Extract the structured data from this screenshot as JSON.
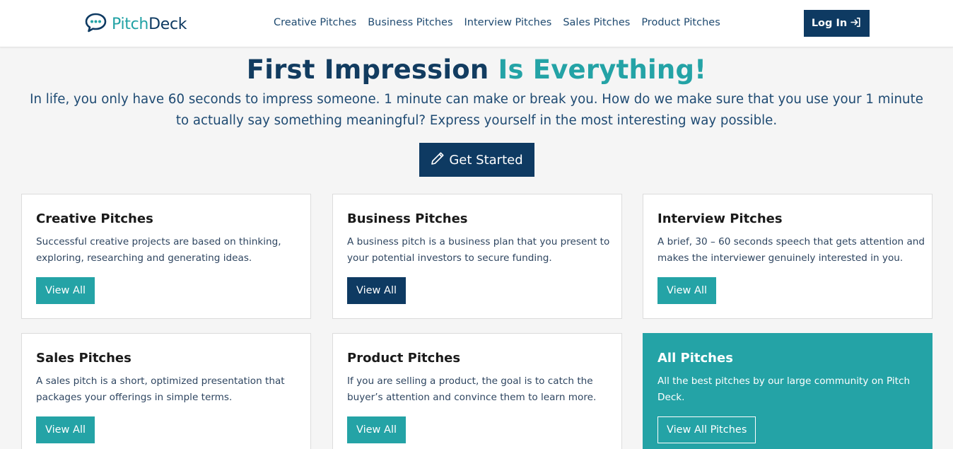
{
  "brand": {
    "pitch": "Pitch",
    "deck": "Deck"
  },
  "nav": {
    "links": [
      "Creative Pitches",
      "Business Pitches",
      "Interview Pitches",
      "Sales Pitches",
      "Product Pitches"
    ],
    "login_label": "Log In"
  },
  "hero": {
    "title_main": "First Impression",
    "title_accent": "Is Everything!",
    "text": "In life, you only have 60 seconds to impress someone. 1 minute can make or break you. How do we make sure that you use your 1 minute to actually say something meaningful? Express yourself in the most interesting way possible.",
    "cta_label": "Get Started"
  },
  "cards": [
    {
      "title": "Creative Pitches",
      "text": "Successful creative projects are based on thinking, exploring, researching and generating ideas.",
      "button": "View All"
    },
    {
      "title": "Business Pitches",
      "text": "A business pitch is a business plan that you present to your potential investors to secure funding.",
      "button": "View All"
    },
    {
      "title": "Interview Pitches",
      "text": "A brief, 30 – 60 seconds speech that gets attention and makes the interviewer genuinely interested in you.",
      "button": "View All"
    },
    {
      "title": "Sales Pitches",
      "text": "A sales pitch is a short, optimized presentation that packages your offerings in simple terms.",
      "button": "View All"
    },
    {
      "title": "Product Pitches",
      "text": "If you are selling a product, the goal is to catch the buyer’s attention and convince them to learn more.",
      "button": "View All"
    },
    {
      "title": "All Pitches",
      "text": "All the best pitches by our large community on Pitch Deck.",
      "button": "View All Pitches"
    }
  ],
  "colors": {
    "primary": "#0e3a62",
    "accent": "#24a3a6",
    "background": "#f5f5f5"
  },
  "icons": {
    "logo": "chat-bubble-icon",
    "login": "sign-in-icon",
    "cta": "pencil-icon"
  }
}
